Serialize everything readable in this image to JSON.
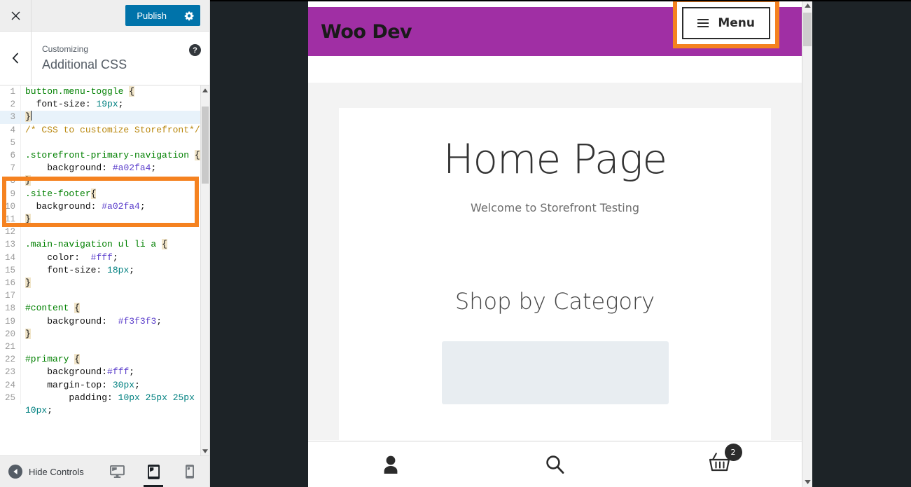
{
  "customizer": {
    "close_label": "Close customizer",
    "publish_label": "Publish",
    "gear_icon": "gear-icon",
    "back_label": "Back",
    "eyebrow": "Customizing",
    "title": "Additional CSS",
    "help_label": "?",
    "hide_controls_label": "Hide Controls",
    "devices": [
      {
        "name": "desktop",
        "label": "Desktop",
        "active": false
      },
      {
        "name": "tablet",
        "label": "Tablet",
        "active": true
      },
      {
        "name": "mobile",
        "label": "Mobile",
        "active": false
      }
    ],
    "editor": {
      "active_line": 3,
      "lines": [
        {
          "n": "1",
          "text": "button.menu-toggle {"
        },
        {
          "n": "2",
          "text": "  font-size: 19px;"
        },
        {
          "n": "3",
          "text": "}"
        },
        {
          "n": "4",
          "text": "/* CSS to customize Storefront*/"
        },
        {
          "n": "5",
          "text": ""
        },
        {
          "n": "6",
          "text": ".storefront-primary-navigation {"
        },
        {
          "n": "7",
          "text": "    background: #a02fa4;"
        },
        {
          "n": "8",
          "text": "}"
        },
        {
          "n": "9",
          "text": ".site-footer{"
        },
        {
          "n": "10",
          "text": "  background: #a02fa4;"
        },
        {
          "n": "11",
          "text": "}"
        },
        {
          "n": "12",
          "text": ""
        },
        {
          "n": "13",
          "text": ".main-navigation ul li a {"
        },
        {
          "n": "14",
          "text": "    color:  #fff;"
        },
        {
          "n": "15",
          "text": "    font-size: 18px;"
        },
        {
          "n": "16",
          "text": "}"
        },
        {
          "n": "17",
          "text": ""
        },
        {
          "n": "18",
          "text": "#content {"
        },
        {
          "n": "19",
          "text": "    background:  #f3f3f3;"
        },
        {
          "n": "20",
          "text": "}"
        },
        {
          "n": "21",
          "text": ""
        },
        {
          "n": "22",
          "text": "#primary {"
        },
        {
          "n": "23",
          "text": "    background:#fff;"
        },
        {
          "n": "24",
          "text": "    margin-top: 30px;"
        },
        {
          "n": "25",
          "text": "        padding: 10px 25px 25px 10px;"
        }
      ]
    }
  },
  "preview": {
    "brand": "Woo Dev",
    "menu_label": "Menu",
    "menu_icon": "hamburger-icon",
    "heading": "Home Page",
    "subheading": "Welcome to Storefront Testing",
    "section_heading": "Shop by Category",
    "bottom_bar": [
      {
        "name": "account",
        "icon": "person-icon",
        "label": "My Account"
      },
      {
        "name": "search",
        "icon": "search-icon",
        "label": "Search"
      },
      {
        "name": "cart",
        "icon": "basket-icon",
        "label": "Cart",
        "badge": "2"
      }
    ]
  },
  "colors": {
    "brand_purple": "#a02fa4",
    "publish_blue": "#0073aa",
    "highlight_orange": "#f58220",
    "content_gray": "#f3f3f3",
    "admin_dark": "#1d2327"
  }
}
